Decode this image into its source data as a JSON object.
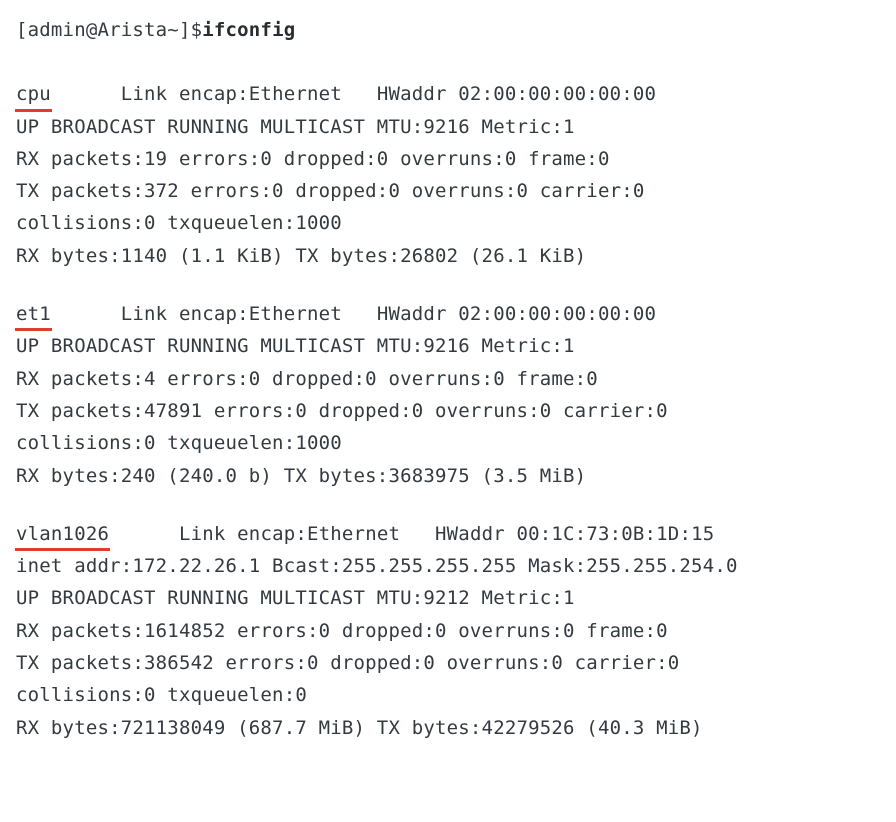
{
  "prompt": "[admin@Arista~]$",
  "command": "ifconfig",
  "interfaces": [
    {
      "name": "cpu",
      "pad_after_name": "      ",
      "lines": [
        "Link encap:Ethernet   HWaddr 02:00:00:00:00:00",
        "UP BROADCAST RUNNING MULTICAST MTU:9216 Metric:1",
        "RX packets:19 errors:0 dropped:0 overruns:0 frame:0",
        "TX packets:372 errors:0 dropped:0 overruns:0 carrier:0",
        "collisions:0 txqueuelen:1000",
        "RX bytes:1140 (1.1 KiB) TX bytes:26802 (26.1 KiB)"
      ]
    },
    {
      "name": "et1",
      "pad_after_name": "      ",
      "lines": [
        "Link encap:Ethernet   HWaddr 02:00:00:00:00:00",
        "UP BROADCAST RUNNING MULTICAST MTU:9216 Metric:1",
        "RX packets:4 errors:0 dropped:0 overruns:0 frame:0",
        "TX packets:47891 errors:0 dropped:0 overruns:0 carrier:0",
        "collisions:0 txqueuelen:1000",
        "RX bytes:240 (240.0 b) TX bytes:3683975 (3.5 MiB)"
      ]
    },
    {
      "name": "vlan1026",
      "pad_after_name": "      ",
      "lines": [
        "Link encap:Ethernet   HWaddr 00:1C:73:0B:1D:15",
        "inet addr:172.22.26.1 Bcast:255.255.255.255 Mask:255.255.254.0",
        "UP BROADCAST RUNNING MULTICAST MTU:9212 Metric:1",
        "RX packets:1614852 errors:0 dropped:0 overruns:0 frame:0",
        "TX packets:386542 errors:0 dropped:0 overruns:0 carrier:0",
        "collisions:0 txqueuelen:0",
        "RX bytes:721138049 (687.7 MiB) TX bytes:42279526 (40.3 MiB)"
      ]
    }
  ]
}
